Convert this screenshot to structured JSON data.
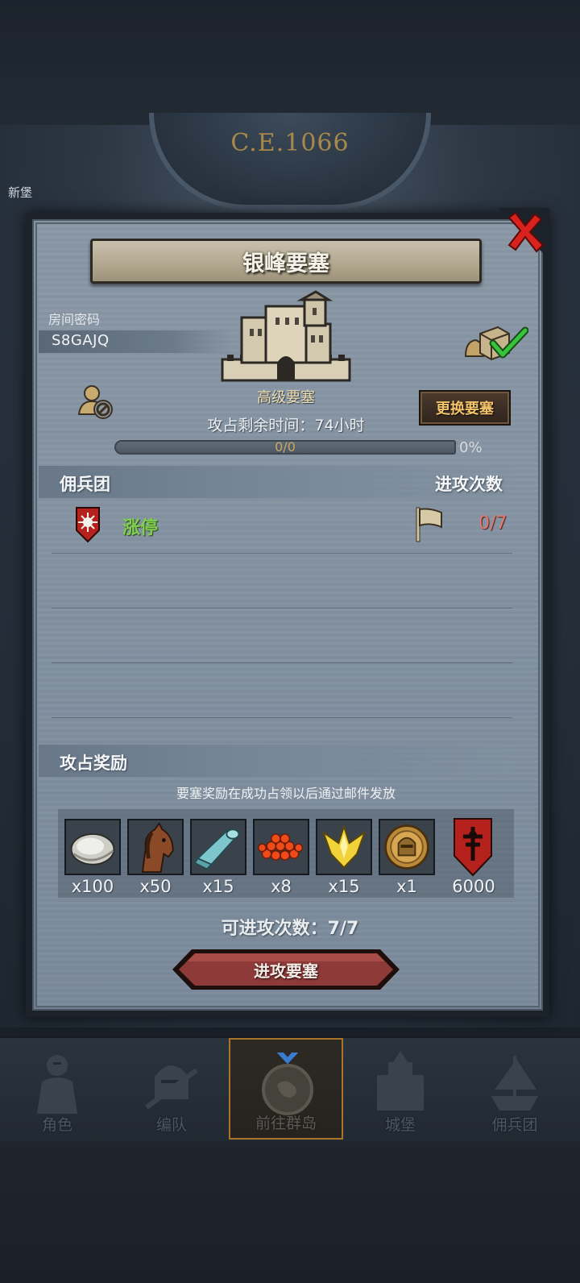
{
  "map": {
    "year": "C.E.1066",
    "side_label": "新堡"
  },
  "dialog": {
    "title": "银峰要塞",
    "room_label": "房间密码",
    "room_code": "S8GAJQ",
    "fortress_tier": "高级要塞",
    "change_button": "更换要塞",
    "capture_time_label": "攻占剩余时间：74小时",
    "progress_text": "0/0",
    "progress_percent": "0%",
    "progress_value": 0,
    "mercenary_header": "佣兵团",
    "attack_count_header": "进攻次数",
    "mercenaries": [
      {
        "name": "涨停",
        "attacks": "0/7"
      }
    ],
    "reward_header": "攻占奖励",
    "reward_note": "要塞奖励在成功占领以后通过邮件发放",
    "rewards": [
      {
        "icon": "oyster-icon",
        "qty": "x100"
      },
      {
        "icon": "horse-icon",
        "qty": "x50"
      },
      {
        "icon": "cloth-roll-icon",
        "qty": "x15"
      },
      {
        "icon": "caviar-icon",
        "qty": "x8"
      },
      {
        "icon": "golden-crown-icon",
        "qty": "x15"
      },
      {
        "icon": "knight-medal-icon",
        "qty": "x1"
      },
      {
        "icon": "banner-shield-icon",
        "qty": "6000"
      }
    ],
    "remaining_attacks_label": "可进攻次数：7/7",
    "attack_button": "进攻要塞"
  },
  "nav": {
    "items": [
      {
        "label": "角色"
      },
      {
        "label": "编队"
      },
      {
        "label": "前往群岛",
        "active": true
      },
      {
        "label": "城堡"
      },
      {
        "label": "佣兵团"
      }
    ]
  },
  "colors": {
    "accent_gold": "#f4c46a",
    "mercenary_green": "#7fd14e",
    "attack_count_red": "#e07a6e",
    "attack_button": "#8e3a38",
    "close_red": "#d8221e"
  }
}
